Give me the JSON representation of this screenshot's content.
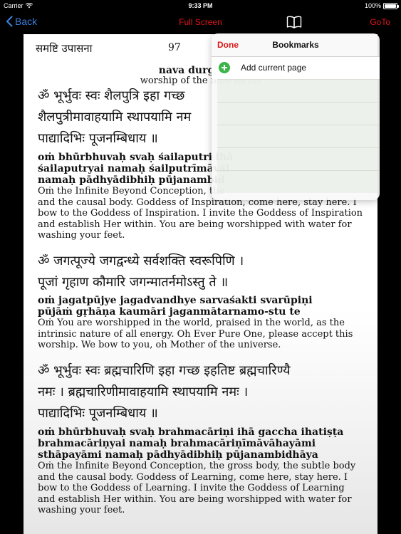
{
  "status_bar": {
    "carrier": "Carrier",
    "time": "9:33 PM",
    "battery": "100%",
    "battery_level": 1.0
  },
  "nav": {
    "back_label": "Back",
    "fullscreen_label": "Full Screen",
    "goto_label": "GoTo",
    "bookmarks_icon": "book-icon"
  },
  "page": {
    "section": "समष्टि उपासना",
    "number": "97",
    "title": "nava durgā pūj",
    "subtitle": "worship of the nine forms",
    "verses": [
      {
        "deva": [
          "ॐ भूर्भुवः स्वः शैलपुत्रि इहा गच्छ",
          "शैलपुत्रीमावाहयामि स्थापयामि नम",
          "पाद्यादिभिः पूजनम्बिधाय ॥"
        ],
        "translit": [
          "oṁ bhūrbhuvaḥ svaḥ śailaputri ihā",
          "śailaputryai namaḥ śailputrīmāvāl",
          "namaḥ pādhyādibhiḥ pūjanambid"
        ],
        "trans": [
          "Oṁ the Infinite Beyond Conception, the",
          "and the causal body. Goddess of Inspiration, come here, stay here. I",
          "bow to the Goddess of Inspiration. I invite the Goddess of Inspiration",
          "and establish Her within. You are being worshipped with water for",
          "washing your feet."
        ]
      },
      {
        "deva": [
          "ॐ जगत्पूज्ये जगद्वन्ध्ये सर्वशक्ति स्वरूपिणि ।",
          "पूजां गृहाण कौमारि जगन्मातर्नमोऽस्तु ते ॥"
        ],
        "translit": [
          "oṁ jagatpūjye jagadvandhye sarvaśakti svarūpiṇi",
          "pūjāṁ gṛhāṇa kaumāri jaganmātarnamo-stu te"
        ],
        "trans": [
          "Oṁ You are worshipped in the world, praised in the world, as the",
          "intrinsic nature of all energy. Oh Ever Pure One, please accept this",
          "worship. We bow to you, oh Mother of the universe."
        ]
      },
      {
        "deva": [
          "ॐ भूर्भुवः स्वः ब्रह्मचारिणि इहा गच्छ इहतिष्ट ब्रह्मचारिण्यै",
          "नमः । ब्रह्मचारिणीमावाहयामि स्थापयामि नमः ।",
          "पाद्यादिभिः पूजनम्बिधाय ॥"
        ],
        "translit": [
          "oṁ bhūrbhuvaḥ svaḥ brahmacāriṇi ihā gaccha ihatiṣṭa",
          "brahmacāriṇyai namaḥ  brahmacāriṇīmāvāhayāmi",
          "sthāpayāmi namaḥ pādhyādibhiḥ pūjanambidhāya"
        ],
        "trans": [
          "Oṁ the Infinite Beyond Conception, the gross body, the subtle body",
          "and the causal body. Goddess of Learning, come here, stay here. I",
          "bow to the Goddess of Learning. I invite the Goddess of Learning",
          "and establish Her within. You are being worshipped with water for",
          "washing your feet."
        ]
      }
    ]
  },
  "bookmarks": {
    "done_label": "Done",
    "title": "Bookmarks",
    "add_label": "Add current page",
    "add_icon": "add-circle-icon",
    "add_icon_color": "#3bb54a"
  },
  "colors": {
    "accent_red": "#e0161a",
    "back_blue": "#3d7dd8"
  }
}
